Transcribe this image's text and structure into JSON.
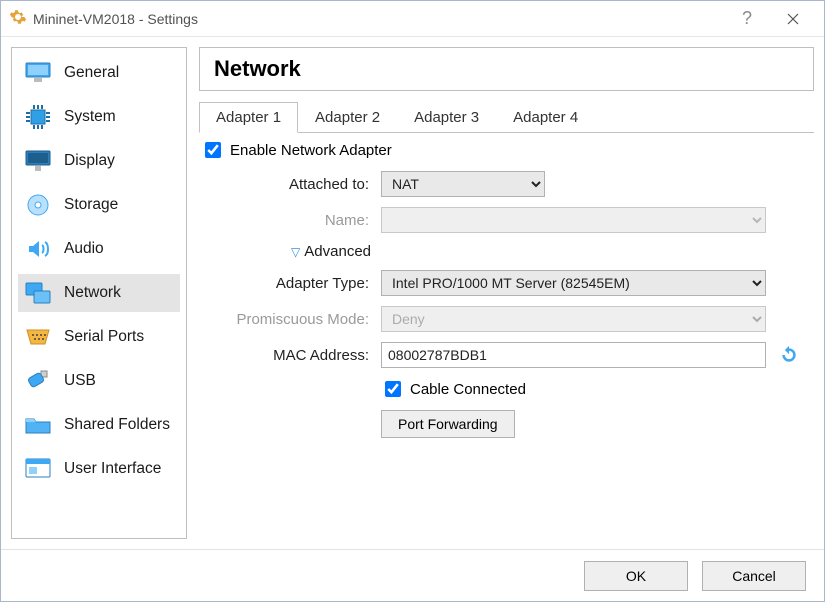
{
  "window": {
    "title": "Mininet-VM2018 - Settings"
  },
  "sidebar": {
    "items": [
      {
        "label": "General",
        "icon": "general"
      },
      {
        "label": "System",
        "icon": "system"
      },
      {
        "label": "Display",
        "icon": "display"
      },
      {
        "label": "Storage",
        "icon": "storage"
      },
      {
        "label": "Audio",
        "icon": "audio"
      },
      {
        "label": "Network",
        "icon": "network",
        "selected": true
      },
      {
        "label": "Serial Ports",
        "icon": "serial"
      },
      {
        "label": "USB",
        "icon": "usb"
      },
      {
        "label": "Shared Folders",
        "icon": "folder"
      },
      {
        "label": "User Interface",
        "icon": "ui"
      }
    ]
  },
  "page": {
    "title": "Network",
    "tabs": [
      "Adapter 1",
      "Adapter 2",
      "Adapter 3",
      "Adapter 4"
    ],
    "activeTab": 0,
    "enable_label": "Enable Network Adapter",
    "enable_checked": true,
    "attached_label": "Attached to:",
    "attached_value": "NAT",
    "name_label": "Name:",
    "name_value": "",
    "advanced_label": "Advanced",
    "adapter_type_label": "Adapter Type:",
    "adapter_type_value": "Intel PRO/1000 MT Server (82545EM)",
    "promiscuous_label": "Promiscuous Mode:",
    "promiscuous_value": "Deny",
    "mac_label": "MAC Address:",
    "mac_value": "08002787BDB1",
    "cable_label": "Cable Connected",
    "cable_checked": true,
    "port_fwd_label": "Port Forwarding"
  },
  "footer": {
    "ok": "OK",
    "cancel": "Cancel"
  }
}
